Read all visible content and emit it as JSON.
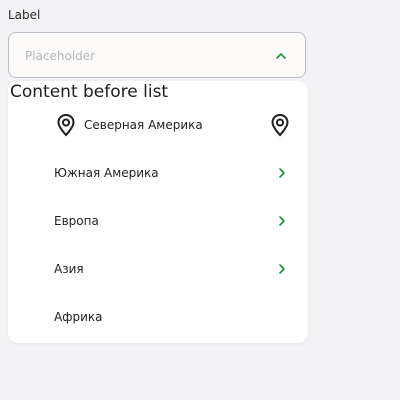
{
  "field": {
    "label": "Label",
    "placeholder": "Placeholder"
  },
  "dropdown": {
    "before_list": "Content before list",
    "items": [
      {
        "label": "Северная Америка",
        "left_icon": "map-pin-icon",
        "right_icon": "map-pin-icon"
      },
      {
        "label": "Южная Америка",
        "right_icon": "chevron-right-icon"
      },
      {
        "label": "Европа",
        "right_icon": "chevron-right-icon"
      },
      {
        "label": "Азия",
        "right_icon": "chevron-right-icon"
      },
      {
        "label": "Африка"
      }
    ]
  },
  "colors": {
    "accent": "#1f8f3a",
    "text": "#1f1f1f",
    "placeholder": "#b3b6ba",
    "border": "#b9bfc6",
    "background": "#f3f3f5"
  }
}
